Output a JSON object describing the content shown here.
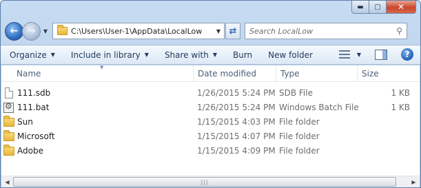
{
  "window": {
    "caption": {
      "minimize": "▬",
      "maximize": "▢",
      "close": "✕"
    }
  },
  "nav": {
    "back_icon": "back-arrow-icon",
    "forward_icon": "forward-arrow-icon",
    "address_path": "C:\\Users\\User-1\\AppData\\LocalLow",
    "search_placeholder": "Search LocalLow"
  },
  "toolbar": {
    "items": [
      {
        "label": "Organize",
        "has_dropdown": true
      },
      {
        "label": "Include in library",
        "has_dropdown": true
      },
      {
        "label": "Share with",
        "has_dropdown": true
      },
      {
        "label": "Burn",
        "has_dropdown": false
      },
      {
        "label": "New folder",
        "has_dropdown": false
      }
    ]
  },
  "columns": [
    "Name",
    "Date modified",
    "Type",
    "Size"
  ],
  "files": [
    {
      "name": "111.sdb",
      "date": "1/26/2015 5:24 PM",
      "type": "SDB File",
      "size": "1 KB",
      "icon": "file-icon"
    },
    {
      "name": "111.bat",
      "date": "1/26/2015 5:24 PM",
      "type": "Windows Batch File",
      "size": "1 KB",
      "icon": "batch-file-icon"
    },
    {
      "name": "Sun",
      "date": "1/15/2015 4:03 PM",
      "type": "File folder",
      "size": "",
      "icon": "folder-icon"
    },
    {
      "name": "Microsoft",
      "date": "1/15/2015 4:07 PM",
      "type": "File folder",
      "size": "",
      "icon": "folder-icon"
    },
    {
      "name": "Adobe",
      "date": "1/15/2015 4:09 PM",
      "type": "File folder",
      "size": "",
      "icon": "folder-icon"
    }
  ],
  "scrollbar": {
    "grip": "|||"
  }
}
